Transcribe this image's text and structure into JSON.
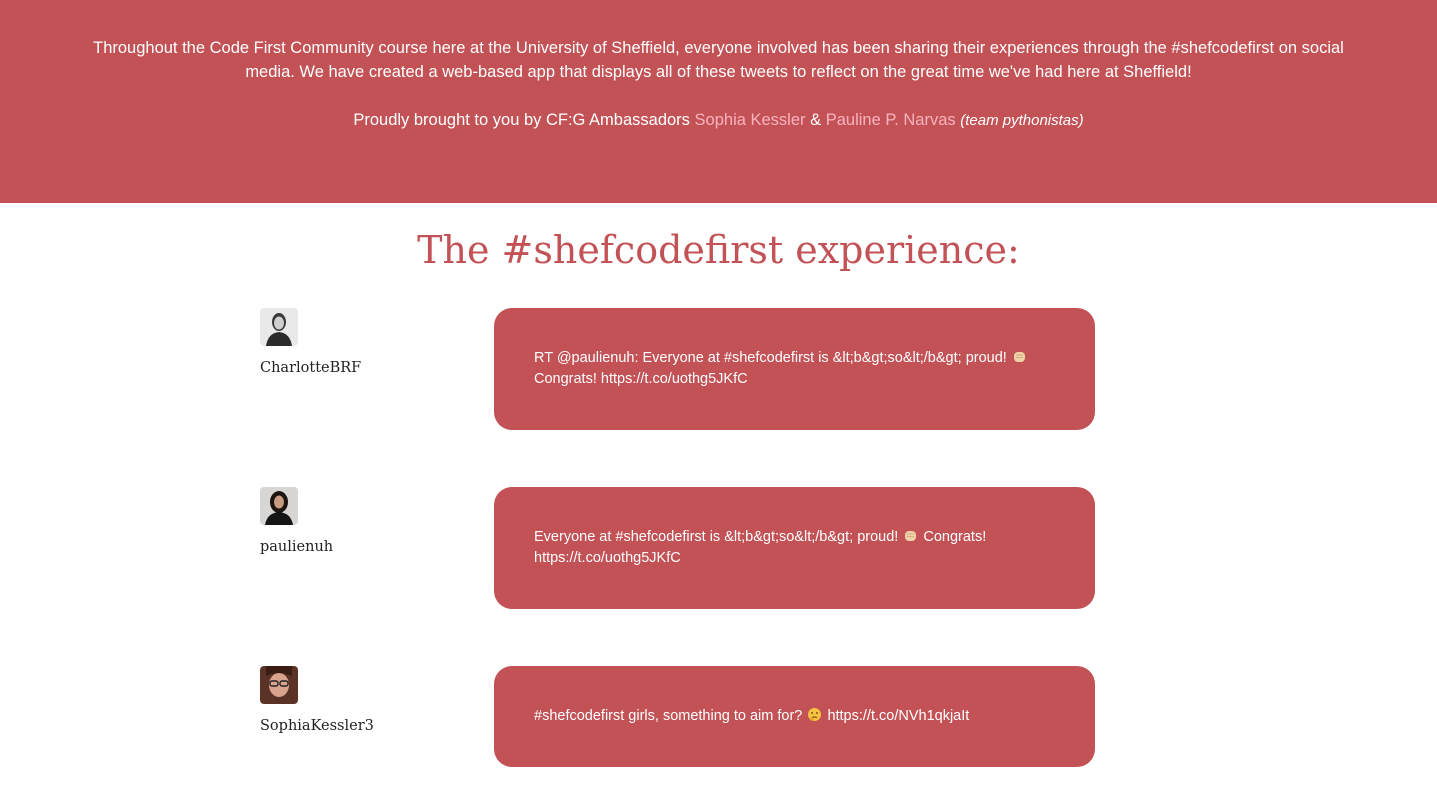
{
  "banner": {
    "intro": "Throughout the Code First Community course here at the University of Sheffield, everyone involved has been sharing their experiences through the #shefcodefirst on social media. We have created a web-based app that displays all of these tweets to reflect on the great time we've had here at Sheffield!",
    "credits_prefix": "Proudly brought to you by CF:G Ambassadors",
    "ambassador_1": "Sophia Kessler",
    "ampersand": "&",
    "ambassador_2": "Pauline P. Narvas",
    "team": "(team pythonistas)",
    "accent_color": "#c35257",
    "link_color": "#f7b3bf"
  },
  "page_title": "The #shefcodefirst experience:",
  "tweets": [
    {
      "username": "CharlotteBRF",
      "avatar_icon": "avatar-photo-grayscale",
      "text_before": "RT @paulienuh: Everyone at #shefcodefirst is &lt;b&gt;so&lt;/b&gt; proud!",
      "emoji": "fist-bump-icon",
      "text_after": "Congrats! https://t.co/uothg5JKfC"
    },
    {
      "username": "paulienuh",
      "avatar_icon": "avatar-photo-dark-hair",
      "text_before": "Everyone at #shefcodefirst is &lt;b&gt;so&lt;/b&gt; proud!",
      "emoji": "fist-bump-icon",
      "text_after": "Congrats! https://t.co/uothg5JKfC"
    },
    {
      "username": "SophiaKessler3",
      "avatar_icon": "avatar-photo-glasses",
      "text_before": "#shefcodefirst girls, something to aim for?",
      "emoji": "thinking-face-icon",
      "text_after": "https://t.co/NVh1qkjaIt"
    }
  ]
}
